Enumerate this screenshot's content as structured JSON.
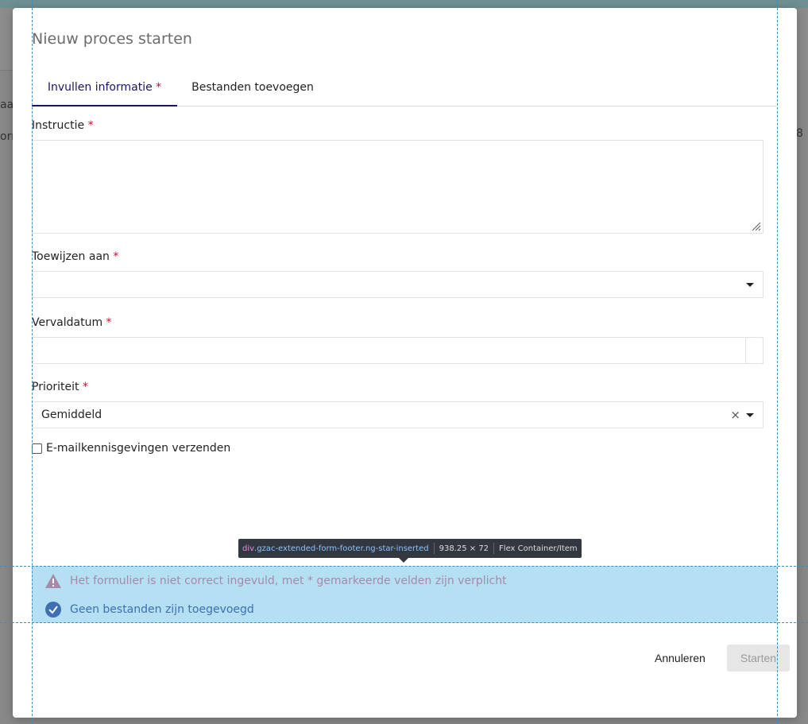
{
  "background": {
    "sidebar_fragment_1": "aad",
    "sidebar_fragment_2": "orra",
    "right_fragment": "8"
  },
  "modal": {
    "title": "Nieuw proces starten",
    "tabs": [
      {
        "label": "Invullen informatie",
        "required_mark": "*",
        "active": true
      },
      {
        "label": "Bestanden toevoegen",
        "active": false
      }
    ],
    "fields": {
      "instructie": {
        "label": "Instructie",
        "required_mark": "*",
        "value": ""
      },
      "toewijzen": {
        "label": "Toewijzen aan",
        "required_mark": "*",
        "value": ""
      },
      "vervaldatum": {
        "label": "Vervaldatum",
        "required_mark": "*",
        "value": ""
      },
      "prioriteit": {
        "label": "Prioriteit",
        "required_mark": "*",
        "value": "Gemiddeld",
        "clear_symbol": "×"
      }
    },
    "checkbox": {
      "label": "E-mailkennisgevingen verzenden",
      "checked": false
    },
    "footer": {
      "warning": "Het formulier is niet correct ingevuld, met * gemarkeerde velden zijn verplicht",
      "info": "Geen bestanden zijn toegevoegd"
    },
    "buttons": {
      "cancel": "Annuleren",
      "start": "Starten"
    }
  },
  "devtools_tooltip": {
    "tag": "div",
    "classes": ".gzac-extended-form-footer.ng-star-inserted",
    "dimensions": "938.25 × 72",
    "kind": "Flex Container/Item"
  },
  "colors": {
    "accent": "#1b1464",
    "required": "#c8102e",
    "highlight": "#78c4e8",
    "warning_text": "#a58aaa",
    "info_text": "#3d6fb2"
  }
}
